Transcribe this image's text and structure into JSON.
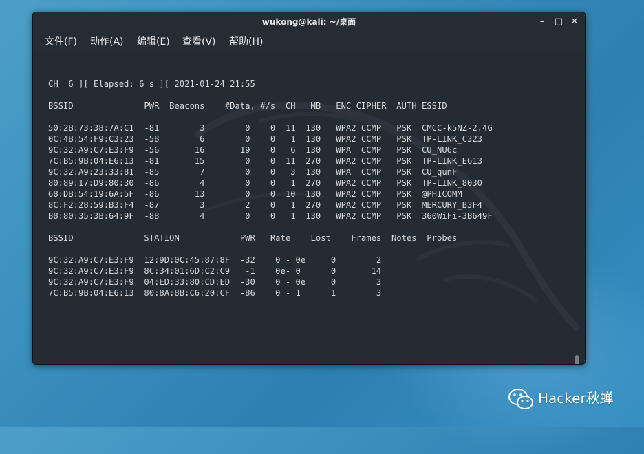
{
  "window": {
    "title": "wukong@kali: ~/桌面",
    "controls": {
      "minimize": "–",
      "maximize": "□",
      "close": "✕"
    }
  },
  "menu": [
    "文件(F)",
    "动作(A)",
    "编辑(E)",
    "查看(V)",
    "帮助(H)"
  ],
  "terminal": {
    "status_line": "CH  6 ][ Elapsed: 6 s ][ 2021-01-24 21:55",
    "ap_header": "BSSID              PWR  Beacons    #Data, #/s  CH   MB   ENC CIPHER  AUTH ESSID",
    "ap_rows": [
      "50:2B:73:38:7A:C1  -81        3        0    0  11  130   WPA2 CCMP   PSK  CMCC-k5NZ-2.4G",
      "0C:4B:54:F9:C3:23  -58        6        0    0   1  130   WPA2 CCMP   PSK  TP-LINK_C323",
      "9C:32:A9:C7:E3:F9  -56       16       19    0   6  130   WPA  CCMP   PSK  CU_NU6c",
      "7C:B5:9B:04:E6:13  -81       15        0    0  11  270   WPA2 CCMP   PSK  TP-LINK_E613",
      "9C:32:A9:23:33:81  -85        7        0    0   3  130   WPA  CCMP   PSK  CU_qunF",
      "80:89:17:D9:80:30  -86        4        0    0   1  270   WPA2 CCMP   PSK  TP-LINK_8030",
      "68:DB:54:19:6A:5F  -86       13        0    0  10  130   WPA2 CCMP   PSK  @PHICOMM",
      "8C:F2:28:59:B3:F4  -87        3        2    0   1  270   WPA2 CCMP   PSK  MERCURY_B3F4",
      "B8:80:35:3B:64:9F  -88        4        0    0   1  130   WPA2 CCMP   PSK  360WiFi-3B649F"
    ],
    "station_header": "BSSID              STATION            PWR   Rate    Lost    Frames  Notes  Probes",
    "station_rows": [
      "9C:32:A9:C7:E3:F9  12:9D:0C:45:87:8F  -32    0 - 0e     0        2",
      "9C:32:A9:C7:E3:F9  8C:34:01:6D:C2:C9   -1    0e- 0      0       14",
      "9C:32:A9:C7:E3:F9  04:ED:33:80:CD:ED  -30    0 - 0e     0        3",
      "7C:B5:9B:04:E6:13  80:8A:8B:C6:20:CF  -86    0 - 1      1        3"
    ]
  },
  "watermark": {
    "text": "Hacker秋蝉",
    "icon": "wechat-icon"
  }
}
